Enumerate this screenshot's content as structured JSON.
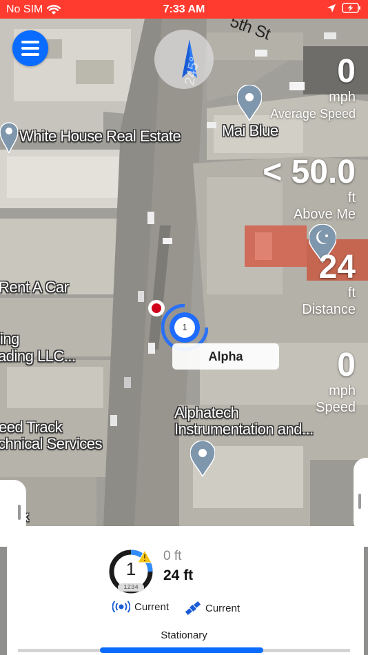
{
  "status_bar": {
    "carrier": "No SIM",
    "time": "7:33 AM"
  },
  "map": {
    "labels": {
      "street": "5th St",
      "white_house": "White House Real Estate",
      "mai_blue": "Mai Blue",
      "rent_a_car": "Rent A Car",
      "ing": "ing",
      "ading": "ading LLC...",
      "speed_track": "eed Track",
      "technical": "chnical Services",
      "alphatech1": "Alphatech",
      "alphatech2": "Instrumentation and...",
      "k": "k"
    },
    "compass_heading": "245°",
    "marker_number": "1",
    "alpha_label": "Alpha"
  },
  "stats": {
    "avg_speed_value": "0",
    "avg_speed_unit": "mph",
    "avg_speed_label": "Average Speed",
    "above_value": "< 50.0",
    "above_unit": "ft",
    "above_label": "Above Me",
    "distance_value": "24",
    "distance_unit": "ft",
    "distance_label": "Distance",
    "speed_value": "0",
    "speed_unit": "mph",
    "speed_label": "Speed"
  },
  "panel": {
    "gauge_number": "1",
    "gauge_sub": "1234",
    "distance_top": "0 ft",
    "distance_bottom": "24 ft",
    "radio_status": "Current",
    "satellite_status": "Current",
    "movement_state": "Stationary"
  },
  "colors": {
    "status_bar": "#ff3b30",
    "accent": "#0a6cff",
    "warning": "#f5c518"
  }
}
